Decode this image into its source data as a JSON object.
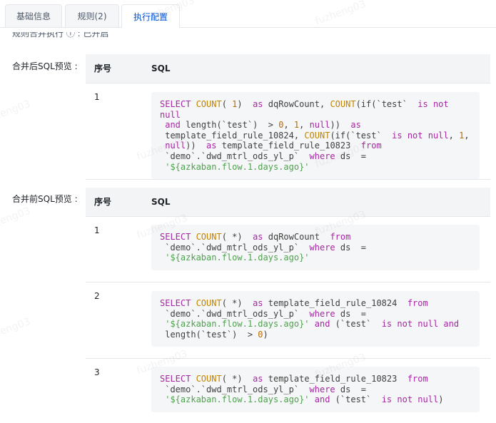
{
  "tabs": [
    {
      "label": "基础信息"
    },
    {
      "label": "规则(2)"
    },
    {
      "label": "执行配置"
    }
  ],
  "cutoff_label": "规则合并执行 ⓘ :  已开启",
  "merged_after": {
    "label": "合并后SQL预览 :",
    "col_index": "序号",
    "col_sql": "SQL",
    "rows": [
      {
        "index": "1",
        "tokens": [
          [
            "kw",
            "SELECT "
          ],
          [
            "fn",
            "COUNT"
          ],
          [
            "id",
            "( "
          ],
          [
            "num",
            "1"
          ],
          [
            "id",
            ")  "
          ],
          [
            "kw",
            "as"
          ],
          [
            "id",
            " dqRowCount, "
          ],
          [
            "fn",
            "COUNT"
          ],
          [
            "id",
            "(if(`test`  "
          ],
          [
            "kw",
            "is not null"
          ],
          [
            "id",
            "\n "
          ],
          [
            "kw",
            "and"
          ],
          [
            "id",
            " length(`test`)  > "
          ],
          [
            "num",
            "0"
          ],
          [
            "id",
            ", "
          ],
          [
            "num",
            "1"
          ],
          [
            "id",
            ", "
          ],
          [
            "kw",
            "null"
          ],
          [
            "id",
            "))  "
          ],
          [
            "kw",
            "as"
          ],
          [
            "id",
            "\n template_field_rule_10824, "
          ],
          [
            "fn",
            "COUNT"
          ],
          [
            "id",
            "(if(`test`  "
          ],
          [
            "kw",
            "is not null"
          ],
          [
            "id",
            ", "
          ],
          [
            "num",
            "1"
          ],
          [
            "id",
            ",\n "
          ],
          [
            "kw",
            "null"
          ],
          [
            "id",
            "))  "
          ],
          [
            "kw",
            "as"
          ],
          [
            "id",
            " template_field_rule_10823  "
          ],
          [
            "kw",
            "from"
          ],
          [
            "id",
            "\n `demo`.`dwd_mtrl_ods_yl_p`  "
          ],
          [
            "kw",
            "where"
          ],
          [
            "id",
            " ds  =\n "
          ],
          [
            "str",
            "'${azkaban.flow.1.days.ago}'"
          ]
        ]
      }
    ]
  },
  "merged_before": {
    "label": "合并前SQL预览 :",
    "col_index": "序号",
    "col_sql": "SQL",
    "rows": [
      {
        "index": "1",
        "tokens": [
          [
            "kw",
            "SELECT "
          ],
          [
            "fn",
            "COUNT"
          ],
          [
            "id",
            "( *)  "
          ],
          [
            "kw",
            "as"
          ],
          [
            "id",
            " dqRowCount  "
          ],
          [
            "kw",
            "from"
          ],
          [
            "id",
            "\n `demo`.`dwd_mtrl_ods_yl_p`  "
          ],
          [
            "kw",
            "where"
          ],
          [
            "id",
            " ds  =\n "
          ],
          [
            "str",
            "'${azkaban.flow.1.days.ago}'"
          ]
        ]
      },
      {
        "index": "2",
        "tokens": [
          [
            "kw",
            "SELECT "
          ],
          [
            "fn",
            "COUNT"
          ],
          [
            "id",
            "( *)  "
          ],
          [
            "kw",
            "as"
          ],
          [
            "id",
            " template_field_rule_10824  "
          ],
          [
            "kw",
            "from"
          ],
          [
            "id",
            "\n `demo`.`dwd_mtrl_ods_yl_p`  "
          ],
          [
            "kw",
            "where"
          ],
          [
            "id",
            " ds  =\n "
          ],
          [
            "str",
            "'${azkaban.flow.1.days.ago}'"
          ],
          [
            "id",
            " "
          ],
          [
            "kw",
            "and"
          ],
          [
            "id",
            " (`test`  "
          ],
          [
            "kw",
            "is not null and"
          ],
          [
            "id",
            "\n length(`test`)  > "
          ],
          [
            "num",
            "0"
          ],
          [
            "id",
            ")"
          ]
        ]
      },
      {
        "index": "3",
        "tokens": [
          [
            "kw",
            "SELECT "
          ],
          [
            "fn",
            "COUNT"
          ],
          [
            "id",
            "( *)  "
          ],
          [
            "kw",
            "as"
          ],
          [
            "id",
            " template_field_rule_10823  "
          ],
          [
            "kw",
            "from"
          ],
          [
            "id",
            "\n `demo`.`dwd_mtrl_ods_yl_p`  "
          ],
          [
            "kw",
            "where"
          ],
          [
            "id",
            " ds  =\n "
          ],
          [
            "str",
            "'${azkaban.flow.1.days.ago}'"
          ],
          [
            "id",
            " "
          ],
          [
            "kw",
            "and"
          ],
          [
            "id",
            " (`test`  "
          ],
          [
            "kw",
            "is not null"
          ],
          [
            "id",
            ")"
          ]
        ]
      }
    ]
  },
  "watermark": "fuzheng03",
  "colors": {
    "accent": "#0052d9",
    "keyword": "#a626a4",
    "function": "#c18401",
    "string": "#50a14f",
    "number": "#b76b01"
  }
}
